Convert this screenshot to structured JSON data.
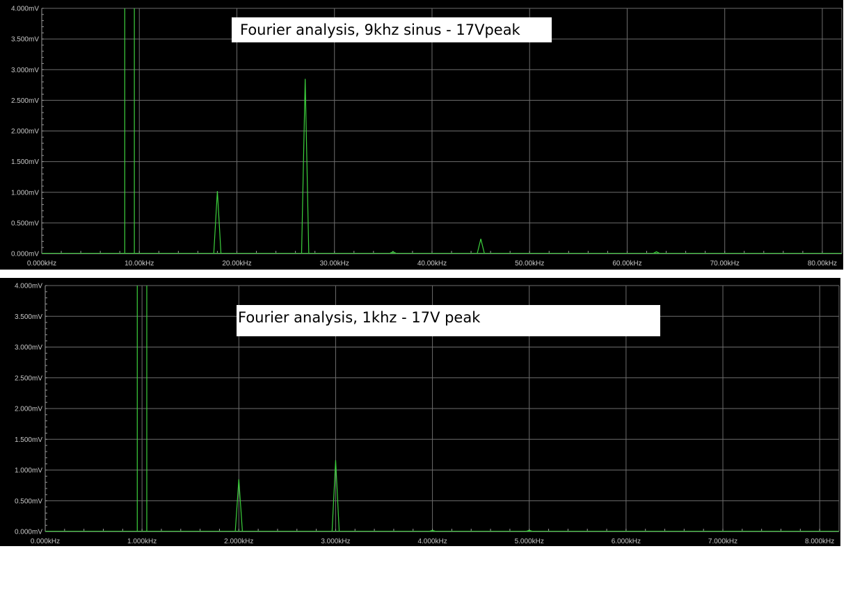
{
  "chart_data": [
    {
      "type": "line",
      "title": "Fourier analysis, 9khz sinus - 17Vpeak",
      "xlabel": "",
      "ylabel": "",
      "xlim": [
        0,
        82
      ],
      "ylim": [
        0,
        4.0
      ],
      "x_unit": "kHz",
      "y_unit": "mV",
      "x_ticks": [
        0,
        10,
        20,
        30,
        40,
        50,
        60,
        70,
        80
      ],
      "x_tick_labels": [
        "0.000kHz",
        "10.00kHz",
        "20.00kHz",
        "30.00kHz",
        "40.00kHz",
        "50.00kHz",
        "60.00kHz",
        "70.00kHz",
        "80.00kHz"
      ],
      "y_ticks": [
        0,
        0.5,
        1.0,
        1.5,
        2.0,
        2.5,
        3.0,
        3.5,
        4.0
      ],
      "y_tick_labels": [
        "0.000mV",
        "0.500mV",
        "1.000mV",
        "1.500mV",
        "2.000mV",
        "2.500mV",
        "3.000mV",
        "3.500mV",
        "4.000mV"
      ],
      "grid": true,
      "series_color": "#3dd13d",
      "peaks": [
        {
          "x": 9.0,
          "y": 4.0,
          "clipped": true
        },
        {
          "x": 18.0,
          "y": 1.02
        },
        {
          "x": 27.0,
          "y": 2.85
        },
        {
          "x": 36.0,
          "y": 0.03
        },
        {
          "x": 45.0,
          "y": 0.24
        },
        {
          "x": 63.0,
          "y": 0.03
        }
      ]
    },
    {
      "type": "line",
      "title": "Fourier analysis, 1khz - 17V peak",
      "xlabel": "",
      "ylabel": "",
      "xlim": [
        0,
        8.2
      ],
      "ylim": [
        0,
        4.0
      ],
      "x_unit": "kHz",
      "y_unit": "mV",
      "x_ticks": [
        0,
        1,
        2,
        3,
        4,
        5,
        6,
        7,
        8
      ],
      "x_tick_labels": [
        "0.000kHz",
        "1.000kHz",
        "2.000kHz",
        "3.000kHz",
        "4.000kHz",
        "5.000kHz",
        "6.000kHz",
        "7.000kHz",
        "8.000kHz"
      ],
      "y_ticks": [
        0,
        0.5,
        1.0,
        1.5,
        2.0,
        2.5,
        3.0,
        3.5,
        4.0
      ],
      "y_tick_labels": [
        "0.000mV",
        "0.500mV",
        "1.000mV",
        "1.500mV",
        "2.000mV",
        "2.500mV",
        "3.000mV",
        "3.500mV",
        "4.000mV"
      ],
      "grid": true,
      "series_color": "#3dd13d",
      "peaks": [
        {
          "x": 1.0,
          "y": 4.0,
          "clipped": true
        },
        {
          "x": 2.0,
          "y": 0.85
        },
        {
          "x": 3.0,
          "y": 1.16
        },
        {
          "x": 4.0,
          "y": 0.02
        },
        {
          "x": 5.0,
          "y": 0.02
        }
      ]
    }
  ]
}
